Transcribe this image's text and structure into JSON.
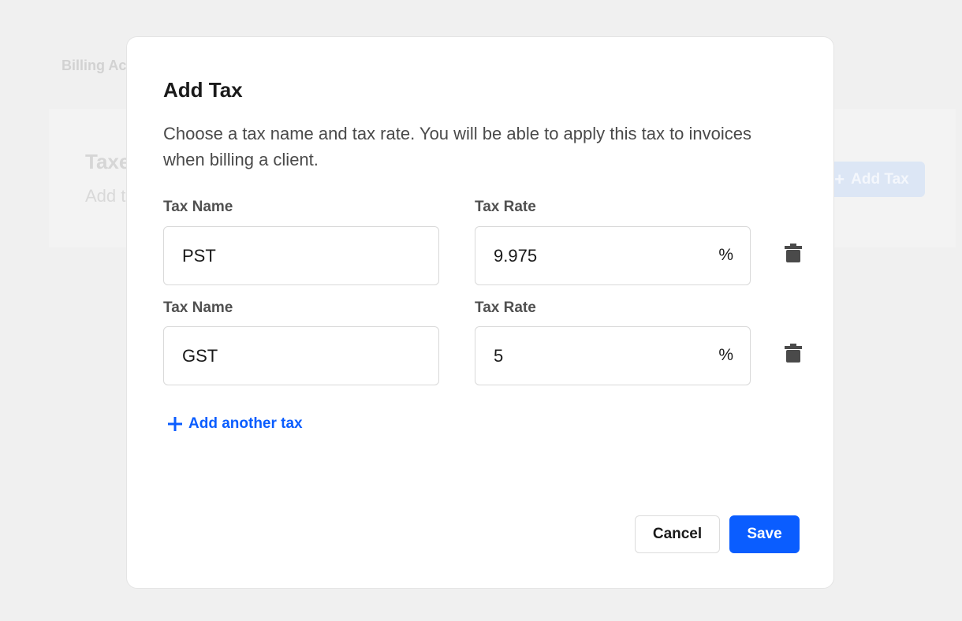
{
  "background": {
    "breadcrumb": "Billing Ac",
    "card_title": "Taxe",
    "card_subtitle": "Add t",
    "add_button_label": "Add Tax"
  },
  "modal": {
    "title": "Add Tax",
    "description": "Choose a tax name and tax rate. You will be able to apply this tax to invoices when billing a client.",
    "name_label": "Tax Name",
    "rate_label": "Tax Rate",
    "percent_symbol": "%",
    "taxes": [
      {
        "name": "PST",
        "rate": "9.975"
      },
      {
        "name": "GST",
        "rate": "5"
      }
    ],
    "add_another_label": "Add another tax",
    "cancel_label": "Cancel",
    "save_label": "Save"
  },
  "colors": {
    "accent": "#0a5dff",
    "overlay_background": "#f0f0f0",
    "icon_dark": "#4a4a4a"
  },
  "icons": {
    "delete": "trash-icon",
    "add": "plus-icon"
  }
}
